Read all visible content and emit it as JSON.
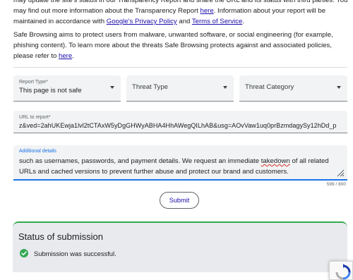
{
  "intro": {
    "line1": "may update the site's status in our Transparency Report and share the URL and its status with third parties. You",
    "line2_before": "may find out more information about the Transparency Report ",
    "line2_link": "here",
    "line2_after": ". Information about your report will be",
    "line3_before": "maintained in accordance with ",
    "line3_link1": "Google's Privacy Policy",
    "line3_mid": " and ",
    "line3_link2": "Terms of Service",
    "line3_after": "."
  },
  "safe_browsing": {
    "line1": "Safe Browsing aims to protect users from malware, unwanted software, or social engineering (for example,",
    "line2": "phishing content). To learn more about the threats Safe Browsing protects against and associated policies,",
    "line3_before": "please refer to ",
    "line3_link": "here",
    "line3_after": "."
  },
  "form": {
    "report_type": {
      "label": "Report Type*",
      "value": "This page is not safe"
    },
    "threat_type": {
      "placeholder": "Threat Type"
    },
    "threat_category": {
      "placeholder": "Threat Category"
    },
    "url": {
      "label": "URL to report*",
      "value": "z&ved=2ahUKEwja1lvl2tCTAxW5yDgGHWyABHA4HhAWegQILhAB&usg=AOvVaw1uq0prBzmdagySy12hDd_p"
    },
    "details": {
      "label": "Additional details",
      "line1_before": "such as usernames, passwords, and payment details. We request an immediate ",
      "line1_squiggle": "takedown",
      "line1_after": " of all related",
      "line2": "URLs and cached versions to prevent further abuse and protect our brand and customers."
    },
    "counter": "599 / 800",
    "submit_label": "Submit"
  },
  "status": {
    "title": "Status of submission",
    "message": "Submission was successful."
  },
  "colors": {
    "link": "#1a0dab",
    "accent": "#1a73e8",
    "success": "#34a853",
    "field_bg": "#f1f3f4"
  }
}
